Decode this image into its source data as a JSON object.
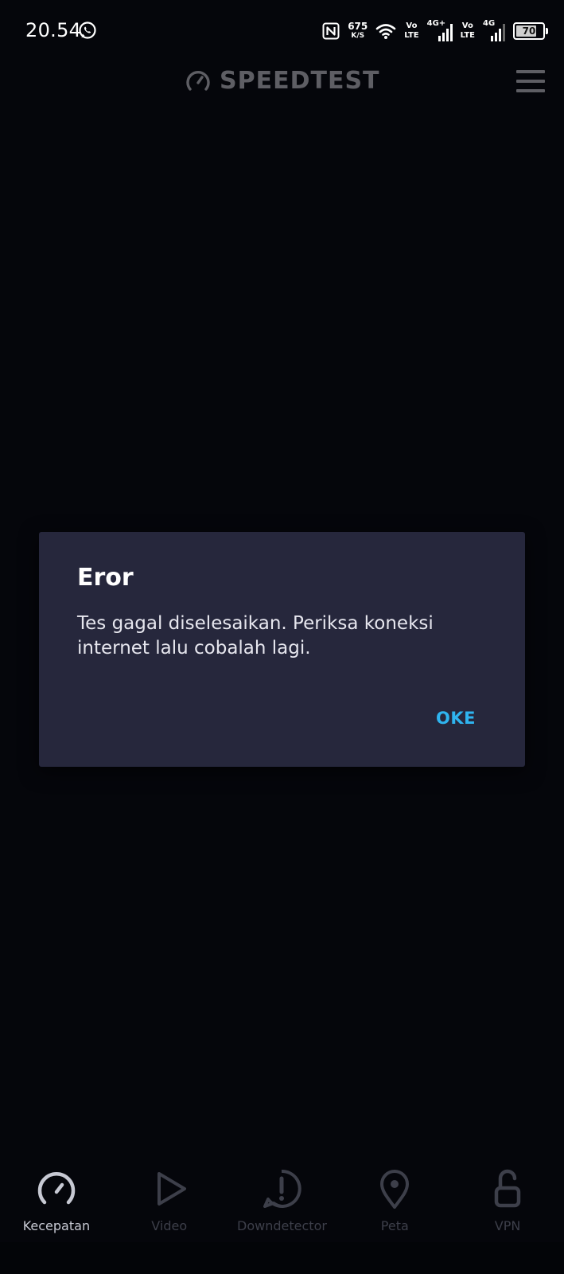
{
  "status_bar": {
    "time": "20.54",
    "net_speed": "675",
    "net_speed_unit": "K/S",
    "sim1_volte_top": "Vo",
    "sim1_volte_bottom": "LTE",
    "sim1_network": "4G+",
    "sim2_volte_top": "Vo",
    "sim2_volte_bottom": "LTE",
    "sim2_network": "4G",
    "battery_level": "70",
    "icons": [
      "whatsapp-icon",
      "nfc-icon",
      "wifi-icon",
      "signal-icon",
      "battery-icon"
    ]
  },
  "header": {
    "app_name": "SPEEDTEST",
    "icons": [
      "speedometer-logo-icon",
      "hamburger-menu-icon"
    ]
  },
  "dialog": {
    "title": "Eror",
    "message": "Tes gagal diselesaikan. Periksa koneksi internet lalu cobalah lagi.",
    "ok_label": "OKE"
  },
  "bottom_nav": {
    "active": "Kecepatan",
    "items": [
      {
        "label": "Kecepatan",
        "icon": "speedometer-icon"
      },
      {
        "label": "Video",
        "icon": "play-icon"
      },
      {
        "label": "Downdetector",
        "icon": "alert-bubble-icon"
      },
      {
        "label": "Peta",
        "icon": "map-pin-icon"
      },
      {
        "label": "VPN",
        "icon": "unlock-icon"
      }
    ]
  },
  "colors": {
    "background": "#05060b",
    "dialog_bg": "#26273c",
    "accent": "#2fb4ef",
    "nav_active": "#c7c9d3",
    "nav_inactive": "#3d3f4a"
  }
}
